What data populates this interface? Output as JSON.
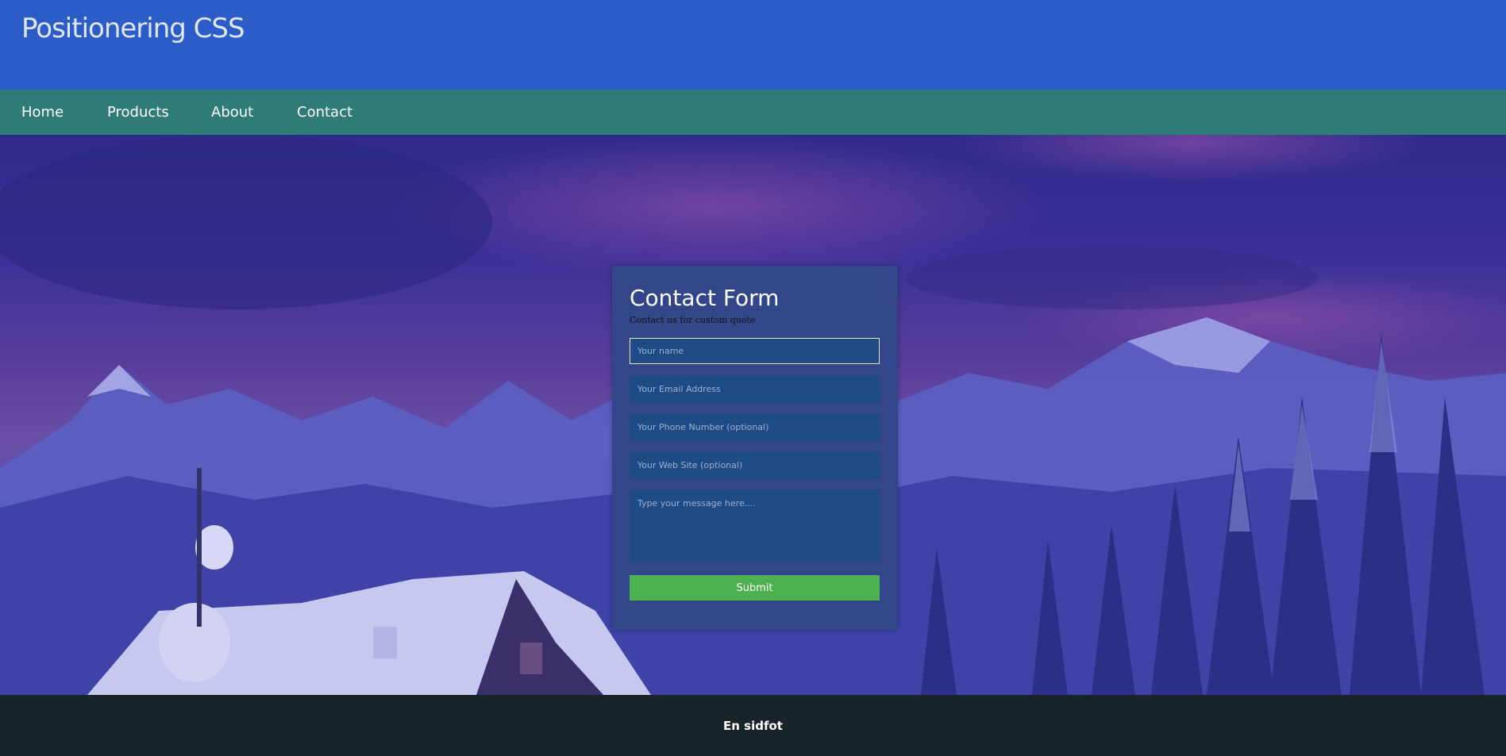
{
  "header": {
    "title": "Positionering CSS"
  },
  "nav": {
    "items": [
      "Home",
      "Products",
      "About",
      "Contact"
    ]
  },
  "form": {
    "title": "Contact Form",
    "subtitle": "Contact us for custom quote",
    "name_placeholder": "Your name",
    "email_placeholder": "Your Email Address",
    "phone_placeholder": "Your Phone Number (optional)",
    "website_placeholder": "Your Web Site (optional)",
    "message_placeholder": "Type your message here....",
    "submit_label": "Submit"
  },
  "footer": {
    "text": "En sidfot"
  },
  "colors": {
    "header_bg": "#2b5cc7",
    "nav_bg": "#2e7b78",
    "form_bg": "#34468a",
    "input_bg": "#1e4a86",
    "submit_bg": "#4db150",
    "footer_bg": "#182428"
  }
}
